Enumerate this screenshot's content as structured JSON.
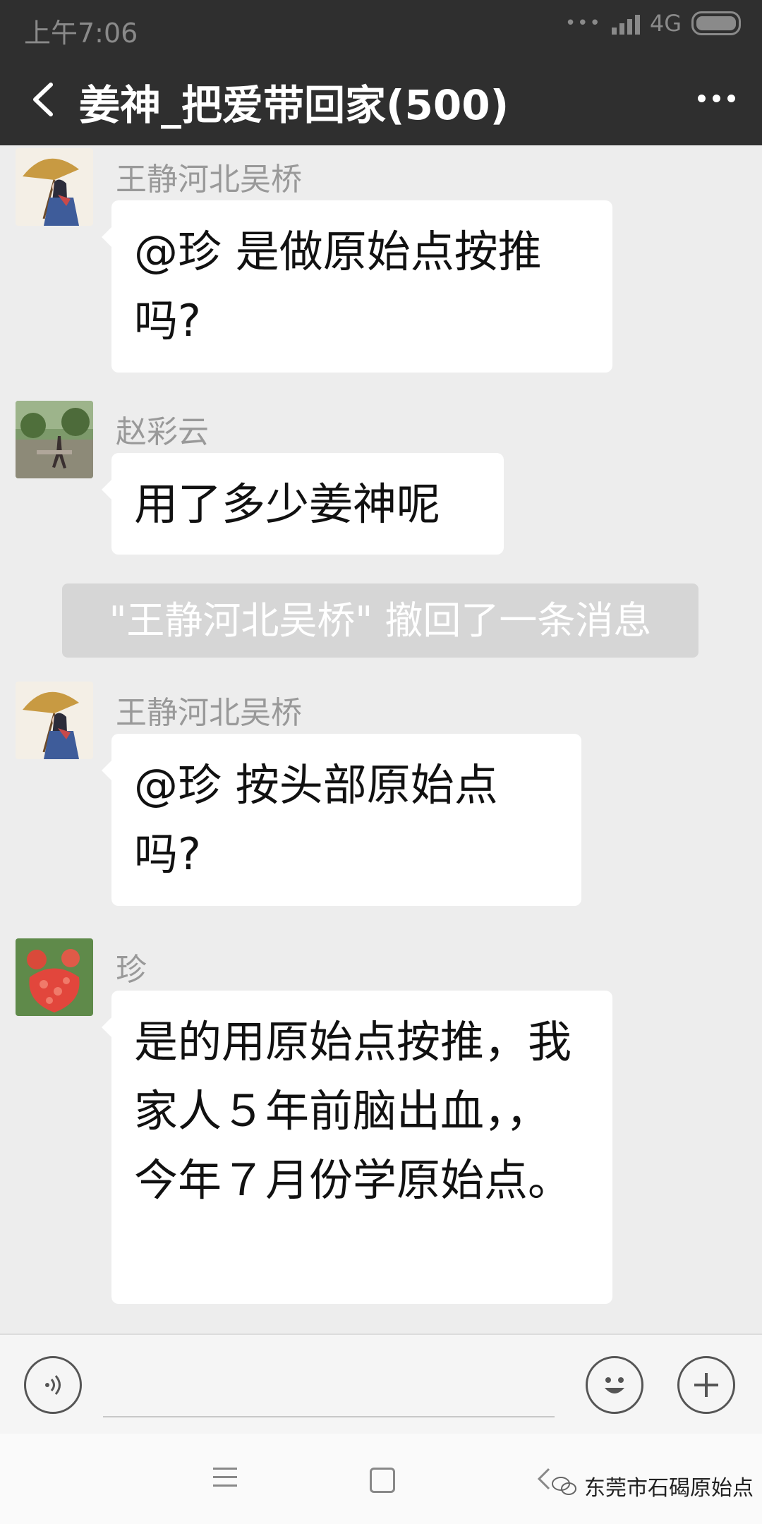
{
  "status_bar": {
    "time": "上午7:06",
    "network": "4G",
    "dots": "•••"
  },
  "header": {
    "title": "姜神_把爱带回家(500)"
  },
  "messages": [
    {
      "sender": "王静河北吴桥",
      "text": "@珍  是做原始点按推吗?"
    },
    {
      "sender": "赵彩云",
      "text": "用了多少姜神呢"
    },
    {
      "sender": "王静河北吴桥",
      "text": "@珍  按头部原始点吗?"
    },
    {
      "sender": "珍",
      "text": "是的用原始点按推，我家人５年前脑出血，，今年７月份学原始点。"
    }
  ],
  "system_notice": "\"王静河北吴桥\" 撤回了一条消息",
  "watermark": "东莞市石碣原始点",
  "colors": {
    "header_bg": "#2f2f2f",
    "chat_bg": "#ededed",
    "bubble_bg": "#ffffff"
  }
}
